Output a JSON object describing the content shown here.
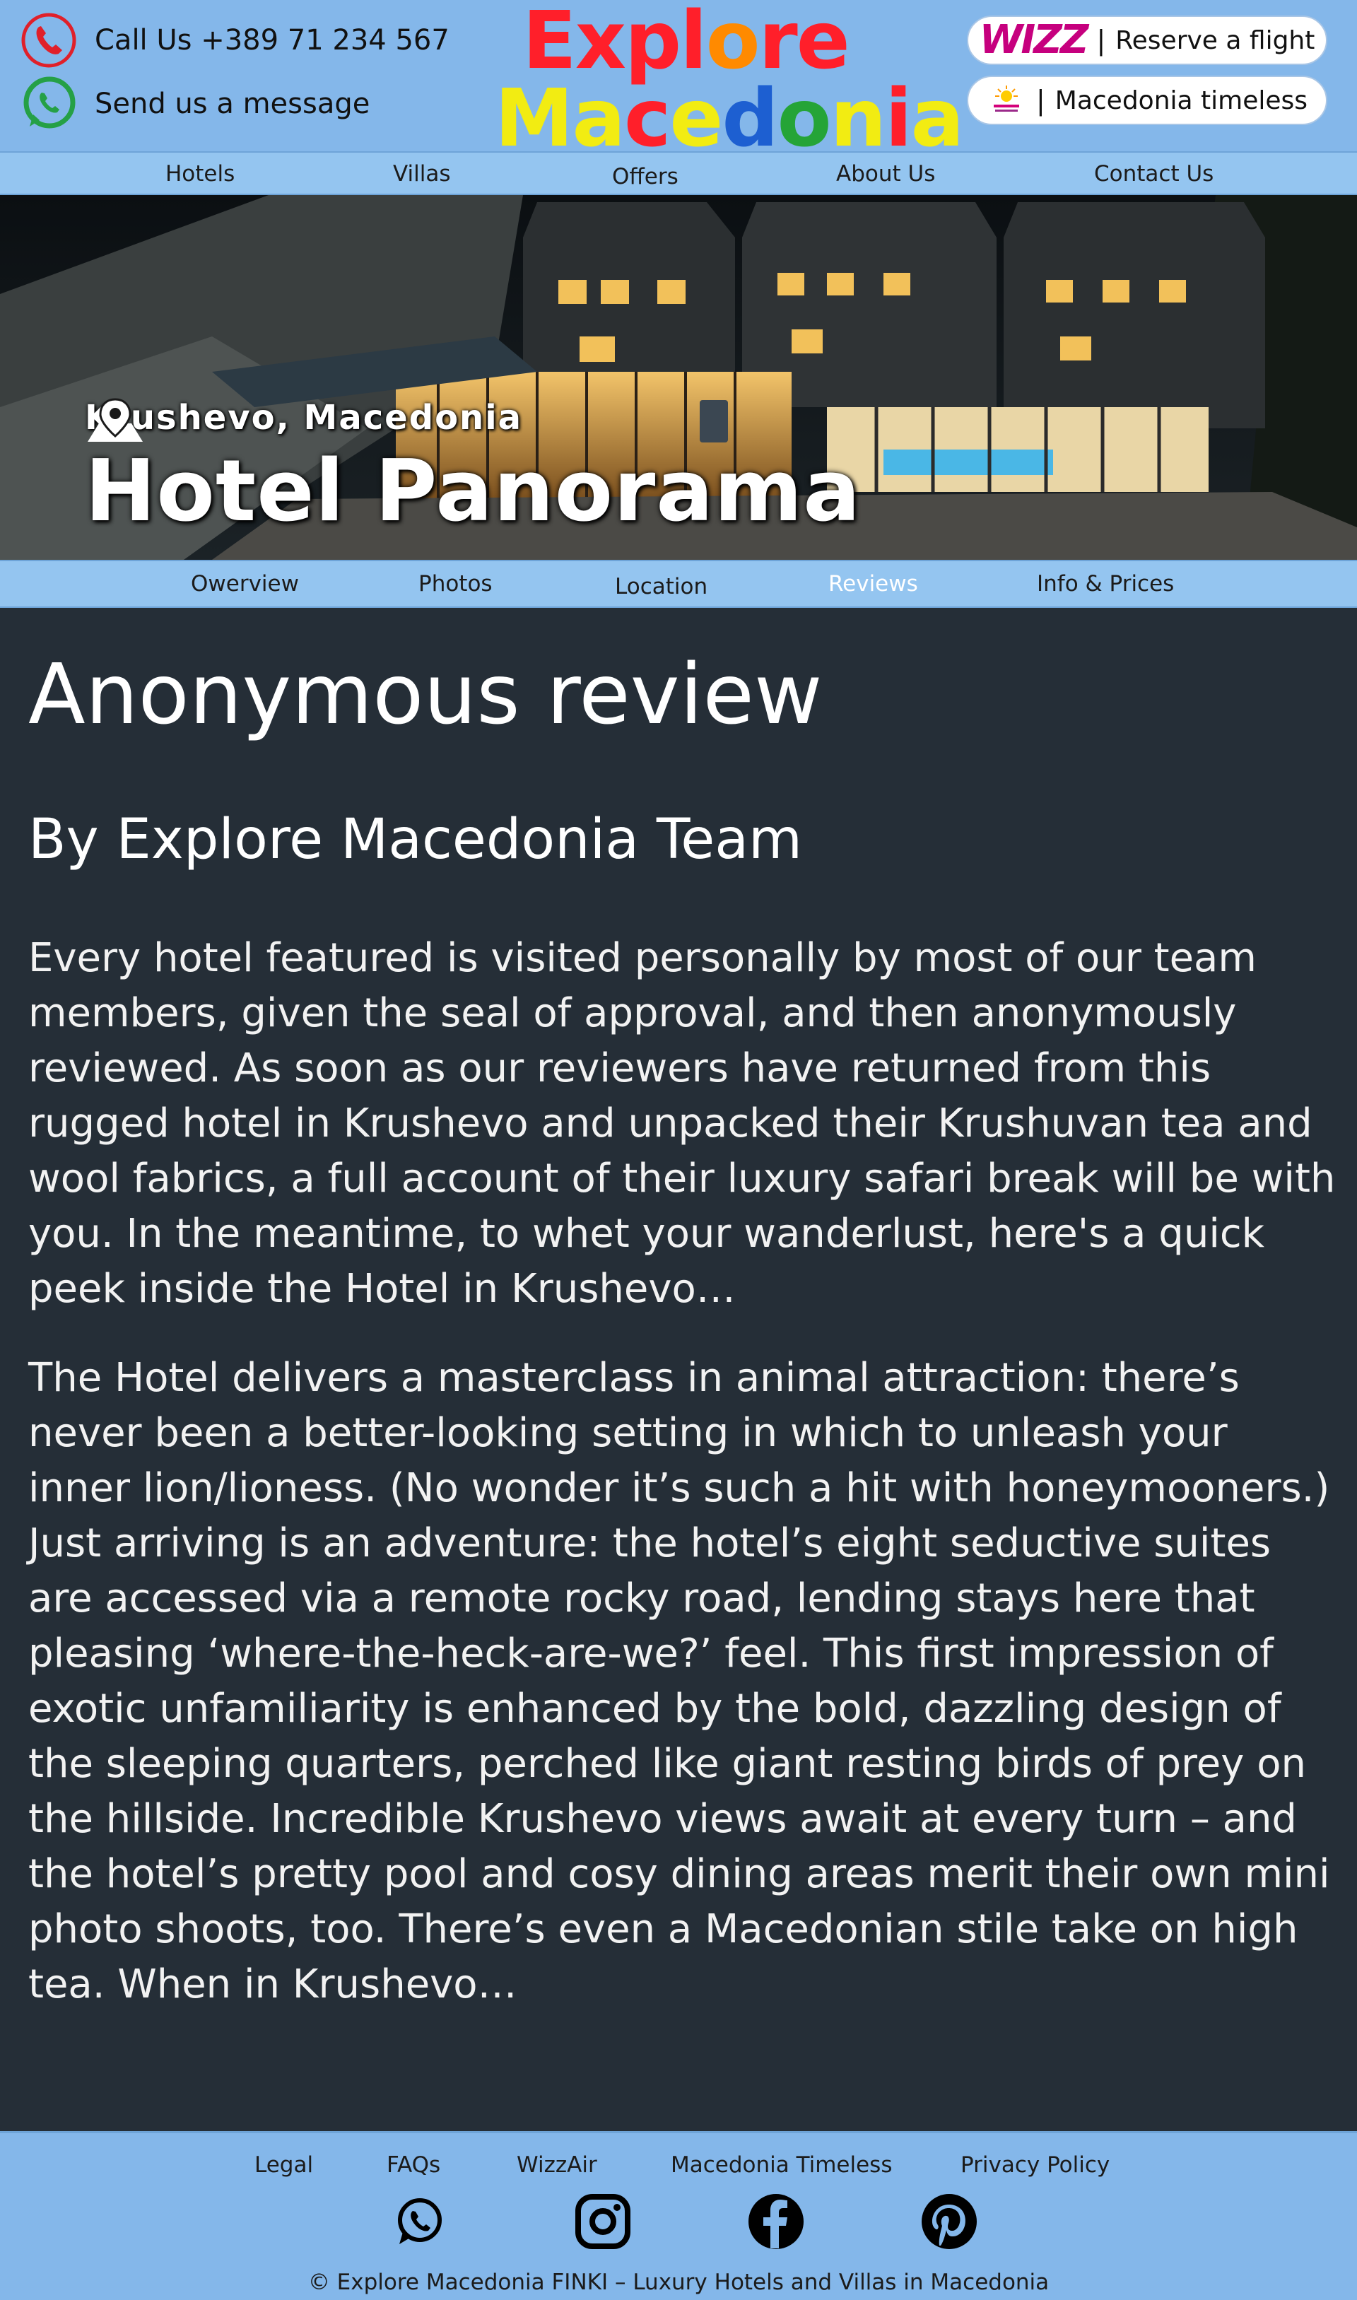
{
  "header": {
    "phone_label": "Call Us +389 71 234 567",
    "message_label": "Send us a message",
    "logo": {
      "line1": [
        {
          "ch": "E",
          "color": "red"
        },
        {
          "ch": "x",
          "color": "red"
        },
        {
          "ch": "p",
          "color": "red"
        },
        {
          "ch": "l",
          "color": "red"
        },
        {
          "ch": "o",
          "color": "orange"
        },
        {
          "ch": "r",
          "color": "red"
        },
        {
          "ch": "e",
          "color": "red"
        }
      ],
      "line2": [
        {
          "ch": "M",
          "color": "yellow"
        },
        {
          "ch": "a",
          "color": "yellow"
        },
        {
          "ch": "c",
          "color": "red"
        },
        {
          "ch": "e",
          "color": "yellow"
        },
        {
          "ch": "d",
          "color": "blue"
        },
        {
          "ch": "o",
          "color": "green"
        },
        {
          "ch": "n",
          "color": "yellow"
        },
        {
          "ch": "i",
          "color": "red"
        },
        {
          "ch": "a",
          "color": "yellow"
        }
      ]
    },
    "flight_brand": "WIZZ",
    "flight_label": "Reserve a flight",
    "timeless_label": "Macedonia timeless",
    "separator": "|"
  },
  "main_nav": [
    "Hotels",
    "Villas",
    "Offers",
    "About Us",
    "Contact Us"
  ],
  "hero": {
    "location": "Krushevo, Macedonia",
    "title": "Hotel Panorama"
  },
  "sub_nav": {
    "items": [
      "Owerview",
      "Photos",
      "Location",
      "Reviews",
      "Info & Prices"
    ],
    "active": "Reviews"
  },
  "review": {
    "title": "Anonymous review",
    "byline": "By Explore Macedonia Team",
    "paragraphs": [
      "Every hotel featured is visited personally by most of our team members, given the seal of approval, and then anonymously reviewed. As soon as our reviewers have returned from this rugged hotel in Krushevo and unpacked their Krushuvan tea and wool fabrics, a full account of their luxury safari break will be with you. In the meantime, to whet your wanderlust, here's a quick peek inside the Hotel in Krushevo…",
      "The Hotel delivers a masterclass in animal attraction: there’s never been a better-looking setting in which to unleash your inner lion/lioness. (No wonder it’s such a hit with honeymooners.) Just arriving is an adventure: the hotel’s eight seductive suites are accessed via a remote rocky road, lending stays here that pleasing ‘where-the-heck-are-we?’ feel. This first impression of exotic unfamiliarity is enhanced by the bold, dazzling design of the sleeping quarters, perched like giant resting birds of prey on the hillside. Incredible Krushevo views await at every turn – and the hotel’s pretty pool and cosy dining areas merit their own mini photo shoots, too. There’s even a Macedonian stile take on high tea. When in Krushevo…"
    ]
  },
  "footer": {
    "links": [
      "Legal",
      "FAQs",
      "WizzAir",
      "Macedonia Timeless",
      "Privacy Policy"
    ],
    "social_icons": [
      "whatsapp-icon",
      "instagram-icon",
      "facebook-icon",
      "pinterest-icon"
    ],
    "copyright": "© Explore Macedonia FINKI – Luxury Hotels and Villas in Macedonia"
  },
  "colors": {
    "header_bg": "#84b7ea",
    "nav_bg": "#94c5f0",
    "content_bg": "#252e37",
    "active_nav": "#ffffff",
    "phone_icon": "#e0202a",
    "whatsapp_icon": "#25a046"
  }
}
